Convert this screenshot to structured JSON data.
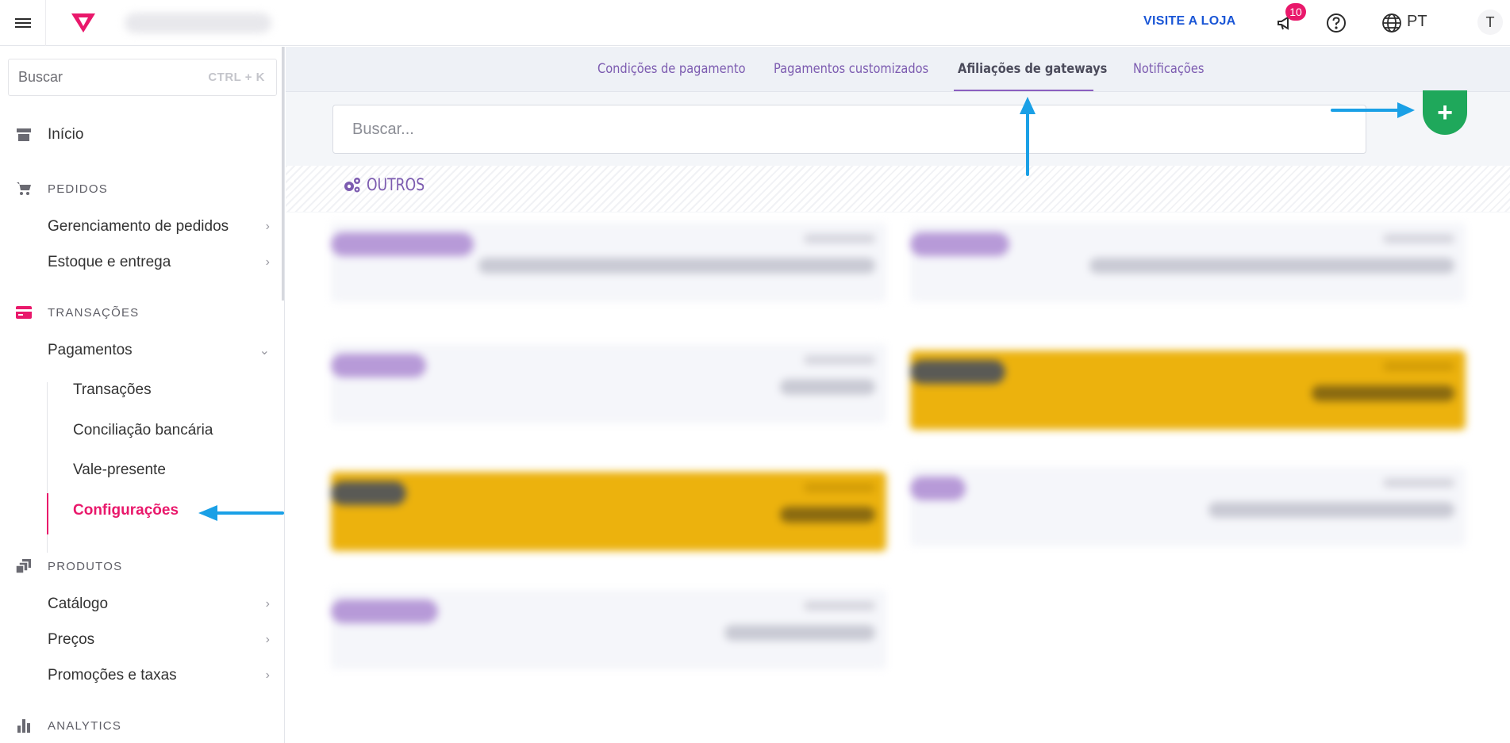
{
  "topbar": {
    "visit_store": "VISITE A LOJA",
    "notifications_count": "10",
    "language": "PT",
    "user_initial": "T"
  },
  "sidebar": {
    "search_placeholder": "Buscar",
    "search_shortcut": "CTRL + K",
    "home": "Início",
    "sections": {
      "orders": "PEDIDOS",
      "transactions": "TRANSAÇÕES",
      "products": "PRODUTOS",
      "analytics": "ANALYTICS"
    },
    "orders_items": [
      "Gerenciamento de pedidos",
      "Estoque e entrega"
    ],
    "payments": "Pagamentos",
    "payments_items": [
      "Transações",
      "Conciliação bancária",
      "Vale-presente",
      "Configurações"
    ],
    "products_items": [
      "Catálogo",
      "Preços",
      "Promoções e taxas"
    ],
    "accent_color": "#e9186b"
  },
  "main": {
    "tabs": [
      {
        "label": "Condições de pagamento",
        "active": false
      },
      {
        "label": "Pagamentos customizados",
        "active": false
      },
      {
        "label": "Afiliações de gateways",
        "active": true
      },
      {
        "label": "Notificações",
        "active": false
      }
    ],
    "search_placeholder": "Buscar...",
    "add_label": "+",
    "section_title": "OUTROS",
    "brand_purple": "#7c5bb0",
    "add_green": "#1fa85b"
  }
}
